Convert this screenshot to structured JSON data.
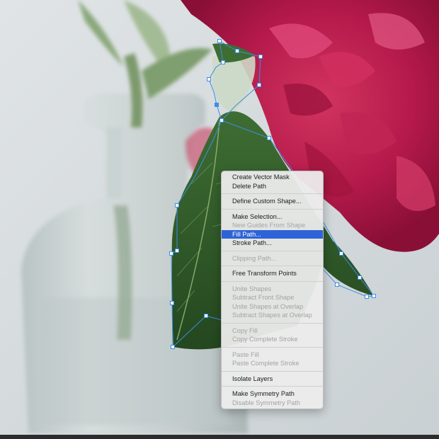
{
  "context_menu": {
    "groups": [
      [
        {
          "label": "Create Vector Mask",
          "enabled": true
        },
        {
          "label": "Delete Path",
          "enabled": true
        }
      ],
      [
        {
          "label": "Define Custom Shape...",
          "enabled": true
        }
      ],
      [
        {
          "label": "Make Selection...",
          "enabled": true
        },
        {
          "label": "New Guides From Shape",
          "enabled": false
        },
        {
          "label": "Fill Path...",
          "enabled": true,
          "highlighted": true
        },
        {
          "label": "Stroke Path...",
          "enabled": true
        }
      ],
      [
        {
          "label": "Clipping Path...",
          "enabled": false
        }
      ],
      [
        {
          "label": "Free Transform Points",
          "enabled": true
        }
      ],
      [
        {
          "label": "Unite Shapes",
          "enabled": false
        },
        {
          "label": "Subtract Front Shape",
          "enabled": false
        },
        {
          "label": "Unite Shapes at Overlap",
          "enabled": false
        },
        {
          "label": "Subtract Shapes at Overlap",
          "enabled": false
        }
      ],
      [
        {
          "label": "Copy Fill",
          "enabled": false
        },
        {
          "label": "Copy Complete Stroke",
          "enabled": false
        }
      ],
      [
        {
          "label": "Paste Fill",
          "enabled": false
        },
        {
          "label": "Paste Complete Stroke",
          "enabled": false
        }
      ],
      [
        {
          "label": "Isolate Layers",
          "enabled": true
        }
      ],
      [
        {
          "label": "Make Symmetry Path",
          "enabled": true
        },
        {
          "label": "Disable Symmetry Path",
          "enabled": false
        }
      ]
    ]
  },
  "colors": {
    "highlight": "#2e63d7",
    "path_stroke": "#3a8ee6",
    "anchor_fill": "#ffffff",
    "flower": "#b01a48",
    "leaf": "#2f5a2a"
  },
  "icons": [
    "anchor-point-icon"
  ]
}
